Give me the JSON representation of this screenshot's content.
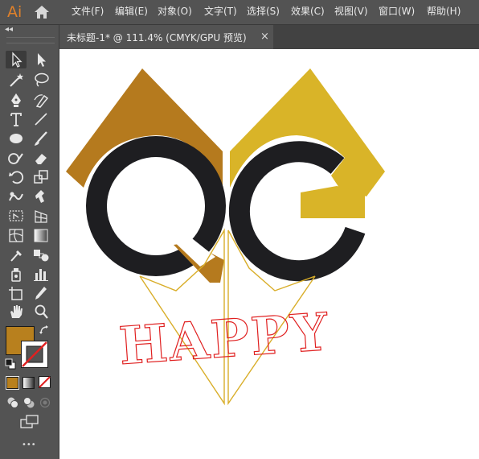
{
  "app": {
    "logo": "Ai"
  },
  "menu": [
    "文件(F)",
    "编辑(E)",
    "对象(O)",
    "文字(T)",
    "选择(S)",
    "效果(C)",
    "视图(V)",
    "窗口(W)",
    "帮助(H)"
  ],
  "document_tab": {
    "label": "未标题-1* @ 111.4% (CMYK/GPU 预览)",
    "close": "×"
  },
  "toolbar": {
    "collapse": "◂◂",
    "more": "•••"
  },
  "colors": {
    "fill": "#B8801E",
    "brand": "#E0812A",
    "gold_dark": "#B57A1E",
    "gold_light": "#D9B428",
    "letters": "#1E1E21",
    "outline_red": "#E02020",
    "outline_gold": "#D9AE2A"
  },
  "artwork": {
    "text": "HAPPY"
  }
}
